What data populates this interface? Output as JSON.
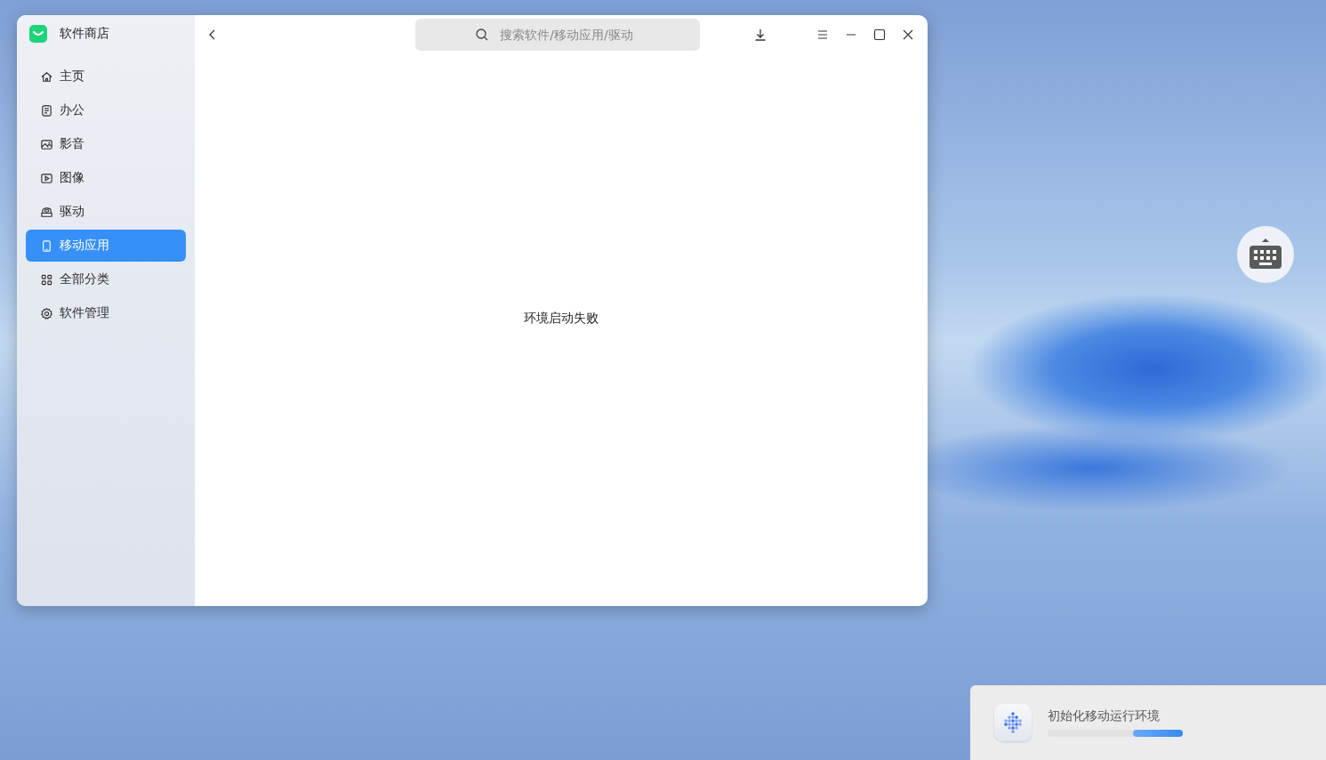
{
  "window": {
    "app_name": "软件商店"
  },
  "sidebar": {
    "items": [
      {
        "label": "主页",
        "selected": false
      },
      {
        "label": "办公",
        "selected": false
      },
      {
        "label": "影音",
        "selected": false
      },
      {
        "label": "图像",
        "selected": false
      },
      {
        "label": "驱动",
        "selected": false
      },
      {
        "label": "移动应用",
        "selected": true
      },
      {
        "label": "全部分类",
        "selected": false
      },
      {
        "label": "软件管理",
        "selected": false
      }
    ]
  },
  "search": {
    "placeholder": "搜索软件/移动应用/驱动"
  },
  "content": {
    "message": "环境启动失败"
  },
  "notification": {
    "text": "初始化移动运行环境"
  }
}
